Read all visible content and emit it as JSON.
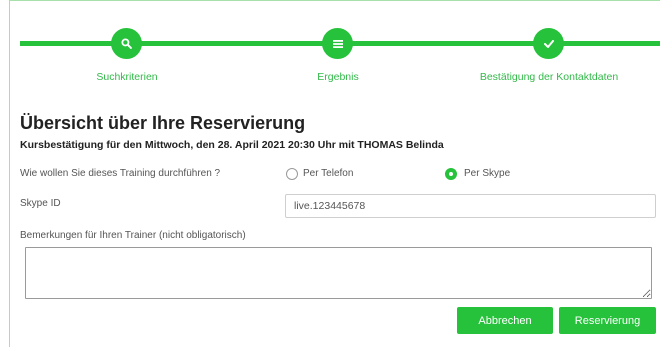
{
  "stepper": {
    "steps": [
      {
        "label": "Suchkriterien",
        "icon": "search-icon"
      },
      {
        "label": "Ergebnis",
        "icon": "list-icon"
      },
      {
        "label": "Bestätigung der Kontaktdaten",
        "icon": "check-icon"
      }
    ]
  },
  "main": {
    "title": "Übersicht über Ihre Reservierung",
    "subtitle": "Kursbestätigung für den Mittwoch, den 28. April 2021 20:30 Uhr mit THOMAS Belinda"
  },
  "form": {
    "training_mode": {
      "label": "Wie wollen Sie dieses Training durchführen ?",
      "options": [
        {
          "label": "Per Telefon",
          "selected": false
        },
        {
          "label": "Per Skype",
          "selected": true
        }
      ]
    },
    "skype_id": {
      "label": "Skype ID",
      "value": "live.123445678"
    },
    "remarks": {
      "label": "Bemerkungen für Ihren Trainer (nicht obligatorisch)",
      "value": ""
    }
  },
  "actions": {
    "cancel_label": "Abbrechen",
    "submit_label": "Reservierung"
  },
  "colors": {
    "accent": "#26c23b",
    "accent_text": "#33b94a",
    "frame": "#a8e0ac"
  }
}
